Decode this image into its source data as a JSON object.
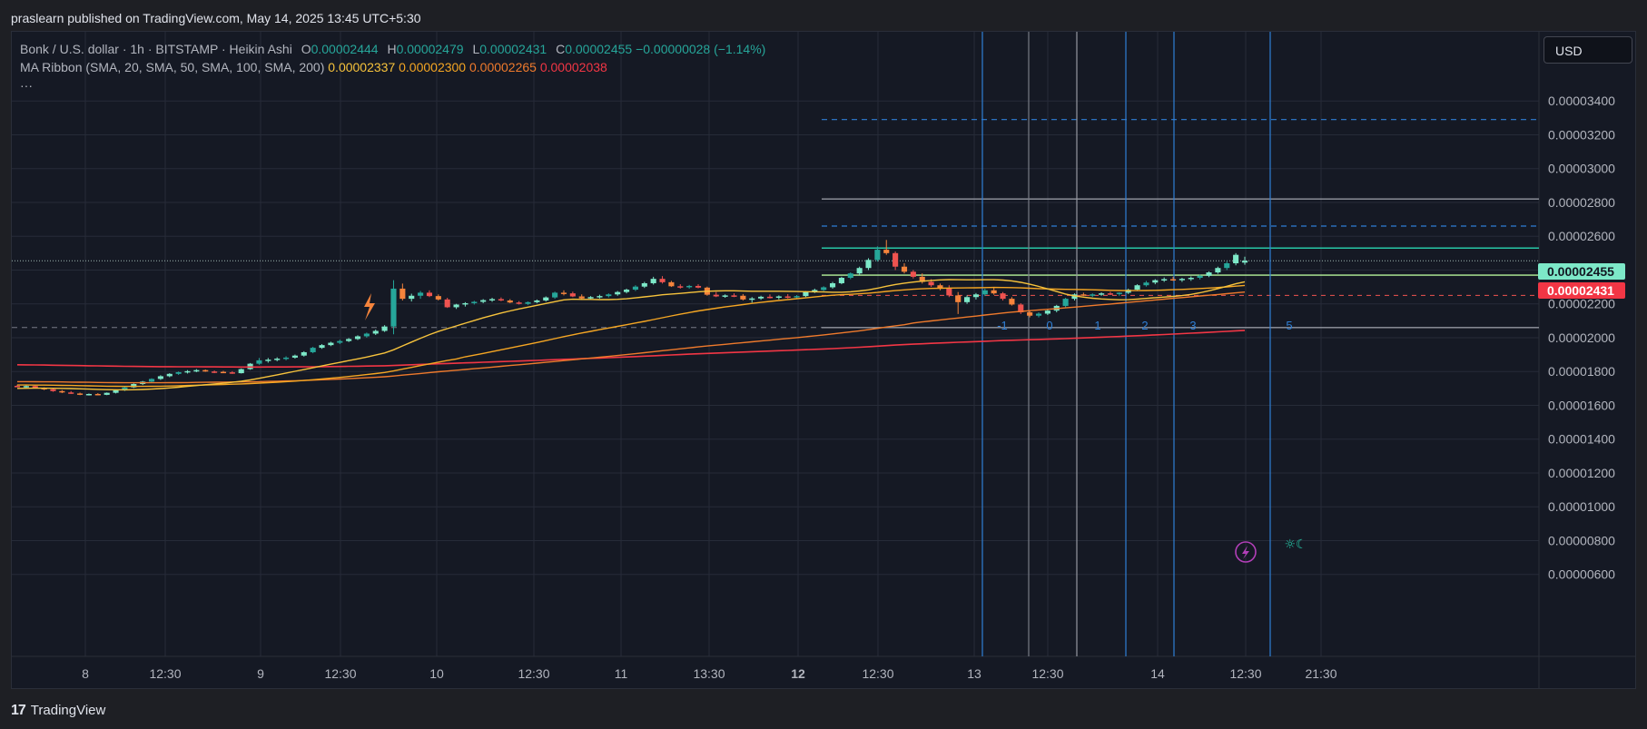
{
  "header": {
    "published": "praslearn published on TradingView.com, May 14, 2025 13:45 UTC+5:30"
  },
  "legend": {
    "symbol": "Bonk / U.S. dollar · 1h · BITSTAMP · Heikin Ashi",
    "o_label": "O",
    "o": "0.00002444",
    "h_label": "H",
    "h": "0.00002479",
    "l_label": "L",
    "l": "0.00002431",
    "c_label": "C",
    "c": "0.00002455",
    "change": "−0.00000028 (−1.14%)",
    "ma_title": "MA Ribbon (SMA, 20, SMA, 50, SMA, 100, SMA, 200)",
    "ma_values": [
      "0.00002337",
      "0.00002300",
      "0.00002265",
      "0.00002038"
    ],
    "more": "···"
  },
  "currency_button": "USD",
  "price_tags": {
    "last": "0.00002455",
    "low": "0.00002431"
  },
  "footer": {
    "brand": "TradingView"
  },
  "colors": {
    "bg": "#151924",
    "up": "#26a69a",
    "up_light": "#7de8c8",
    "down": "#ef5350",
    "down_orange": "#f5843c",
    "ma20": "#f7c33c",
    "ma50": "#f5a623",
    "ma100": "#ef7a2c",
    "ma200": "#f23645",
    "grid": "#262b38",
    "fib_blue": "#2f7fd6",
    "level_teal": "#26c6a6",
    "level_green": "#b7f59a"
  },
  "chart_data": {
    "type": "candlestick",
    "style": "Heikin Ashi",
    "interval": "1h",
    "y_axis": {
      "min": 5e-07,
      "max": 3.5e-06,
      "ticks": [
        "0.00003400",
        "0.00003200",
        "0.00003000",
        "0.00002800",
        "0.00002600",
        "0.00002400",
        "0.00002200",
        "0.00002000",
        "0.00001800",
        "0.00001600",
        "0.00001400",
        "0.00001200",
        "0.00001000",
        "0.00000800",
        "0.00000600"
      ]
    },
    "x_axis": {
      "ticks": [
        "8",
        "12:30",
        "9",
        "12:30",
        "10",
        "12:30",
        "11",
        "13:30",
        "12",
        "12:30",
        "13",
        "12:30",
        "14",
        "12:30",
        "21:30"
      ],
      "bold_ticks": [
        "12"
      ]
    },
    "note": "prices are in units of 1e-8 USD (e.g. 2455 = 0.00002455)",
    "candles": [
      [
        1715,
        1722,
        1708,
        1712
      ],
      [
        1712,
        1720,
        1705,
        1714
      ],
      [
        1714,
        1716,
        1700,
        1702
      ],
      [
        1702,
        1706,
        1690,
        1695
      ],
      [
        1695,
        1700,
        1680,
        1684
      ],
      [
        1684,
        1690,
        1672,
        1676
      ],
      [
        1676,
        1684,
        1668,
        1670
      ],
      [
        1670,
        1675,
        1660,
        1664
      ],
      [
        1664,
        1670,
        1658,
        1667
      ],
      [
        1667,
        1672,
        1660,
        1662
      ],
      [
        1662,
        1676,
        1660,
        1674
      ],
      [
        1674,
        1690,
        1670,
        1688
      ],
      [
        1688,
        1710,
        1684,
        1706
      ],
      [
        1706,
        1730,
        1702,
        1726
      ],
      [
        1726,
        1744,
        1720,
        1740
      ],
      [
        1740,
        1760,
        1734,
        1756
      ],
      [
        1756,
        1778,
        1750,
        1772
      ],
      [
        1772,
        1790,
        1766,
        1786
      ],
      [
        1786,
        1800,
        1780,
        1796
      ],
      [
        1796,
        1808,
        1788,
        1802
      ],
      [
        1802,
        1814,
        1796,
        1808
      ],
      [
        1808,
        1812,
        1798,
        1800
      ],
      [
        1800,
        1806,
        1790,
        1798
      ],
      [
        1798,
        1804,
        1790,
        1795
      ],
      [
        1795,
        1802,
        1786,
        1790
      ],
      [
        1790,
        1818,
        1788,
        1814
      ],
      [
        1814,
        1850,
        1810,
        1846
      ],
      [
        1846,
        1880,
        1840,
        1866
      ],
      [
        1866,
        1880,
        1852,
        1870
      ],
      [
        1870,
        1884,
        1860,
        1876
      ],
      [
        1876,
        1890,
        1866,
        1882
      ],
      [
        1882,
        1900,
        1876,
        1894
      ],
      [
        1894,
        1920,
        1888,
        1914
      ],
      [
        1914,
        1946,
        1908,
        1940
      ],
      [
        1940,
        1962,
        1934,
        1956
      ],
      [
        1956,
        1976,
        1950,
        1970
      ],
      [
        1970,
        1988,
        1962,
        1980
      ],
      [
        1980,
        1998,
        1974,
        1992
      ],
      [
        1992,
        2014,
        1986,
        2008
      ],
      [
        2008,
        2030,
        2000,
        2024
      ],
      [
        2024,
        2048,
        2016,
        2040
      ],
      [
        2040,
        2074,
        2034,
        2066
      ],
      [
        2066,
        2340,
        2020,
        2290
      ],
      [
        2290,
        2320,
        2220,
        2230
      ],
      [
        2230,
        2260,
        2214,
        2248
      ],
      [
        2248,
        2276,
        2230,
        2266
      ],
      [
        2266,
        2280,
        2240,
        2246
      ],
      [
        2246,
        2256,
        2220,
        2226
      ],
      [
        2226,
        2236,
        2176,
        2180
      ],
      [
        2180,
        2200,
        2170,
        2196
      ],
      [
        2196,
        2210,
        2184,
        2204
      ],
      [
        2204,
        2218,
        2196,
        2212
      ],
      [
        2212,
        2228,
        2204,
        2222
      ],
      [
        2222,
        2236,
        2212,
        2228
      ],
      [
        2228,
        2238,
        2216,
        2220
      ],
      [
        2220,
        2228,
        2204,
        2208
      ],
      [
        2208,
        2216,
        2196,
        2200
      ],
      [
        2200,
        2214,
        2194,
        2210
      ],
      [
        2210,
        2226,
        2204,
        2220
      ],
      [
        2220,
        2244,
        2214,
        2238
      ],
      [
        2238,
        2272,
        2230,
        2266
      ],
      [
        2266,
        2280,
        2250,
        2262
      ],
      [
        2262,
        2272,
        2240,
        2244
      ],
      [
        2244,
        2256,
        2228,
        2232
      ],
      [
        2232,
        2246,
        2224,
        2240
      ],
      [
        2240,
        2254,
        2232,
        2246
      ],
      [
        2246,
        2262,
        2238,
        2256
      ],
      [
        2256,
        2276,
        2248,
        2270
      ],
      [
        2270,
        2290,
        2262,
        2284
      ],
      [
        2284,
        2310,
        2276,
        2302
      ],
      [
        2302,
        2330,
        2294,
        2322
      ],
      [
        2322,
        2360,
        2314,
        2348
      ],
      [
        2348,
        2364,
        2320,
        2328
      ],
      [
        2328,
        2336,
        2300,
        2304
      ],
      [
        2304,
        2316,
        2290,
        2300
      ],
      [
        2300,
        2312,
        2290,
        2306
      ],
      [
        2306,
        2316,
        2292,
        2296
      ],
      [
        2296,
        2302,
        2248,
        2254
      ],
      [
        2254,
        2270,
        2240,
        2244
      ],
      [
        2244,
        2256,
        2236,
        2250
      ],
      [
        2250,
        2262,
        2240,
        2248
      ],
      [
        2248,
        2258,
        2220,
        2226
      ],
      [
        2226,
        2240,
        2208,
        2232
      ],
      [
        2232,
        2248,
        2224,
        2242
      ],
      [
        2242,
        2256,
        2232,
        2236
      ],
      [
        2236,
        2250,
        2226,
        2244
      ],
      [
        2244,
        2258,
        2232,
        2238
      ],
      [
        2238,
        2252,
        2228,
        2246
      ],
      [
        2246,
        2276,
        2240,
        2270
      ],
      [
        2270,
        2290,
        2264,
        2282
      ],
      [
        2282,
        2304,
        2276,
        2298
      ],
      [
        2298,
        2330,
        2290,
        2322
      ],
      [
        2322,
        2360,
        2316,
        2354
      ],
      [
        2354,
        2386,
        2346,
        2380
      ],
      [
        2380,
        2420,
        2370,
        2412
      ],
      [
        2412,
        2470,
        2400,
        2460
      ],
      [
        2460,
        2540,
        2450,
        2520
      ],
      [
        2520,
        2578,
        2490,
        2500
      ],
      [
        2500,
        2510,
        2400,
        2420
      ],
      [
        2420,
        2440,
        2380,
        2390
      ],
      [
        2390,
        2400,
        2350,
        2360
      ],
      [
        2360,
        2380,
        2320,
        2330
      ],
      [
        2330,
        2346,
        2300,
        2310
      ],
      [
        2310,
        2320,
        2280,
        2290
      ],
      [
        2290,
        2310,
        2240,
        2250
      ],
      [
        2250,
        2270,
        2140,
        2210
      ],
      [
        2210,
        2250,
        2200,
        2240
      ],
      [
        2240,
        2264,
        2226,
        2256
      ],
      [
        2256,
        2290,
        2246,
        2280
      ],
      [
        2280,
        2300,
        2254,
        2262
      ],
      [
        2262,
        2270,
        2220,
        2230
      ],
      [
        2230,
        2240,
        2190,
        2196
      ],
      [
        2196,
        2204,
        2140,
        2150
      ],
      [
        2150,
        2160,
        2120,
        2130
      ],
      [
        2130,
        2150,
        2120,
        2142
      ],
      [
        2142,
        2168,
        2134,
        2160
      ],
      [
        2160,
        2194,
        2150,
        2188
      ],
      [
        2188,
        2236,
        2180,
        2230
      ],
      [
        2230,
        2262,
        2220,
        2256
      ],
      [
        2256,
        2266,
        2246,
        2250
      ],
      [
        2250,
        2262,
        2240,
        2256
      ],
      [
        2256,
        2268,
        2248,
        2262
      ],
      [
        2262,
        2272,
        2252,
        2258
      ],
      [
        2258,
        2268,
        2248,
        2266
      ],
      [
        2266,
        2290,
        2258,
        2284
      ],
      [
        2284,
        2316,
        2276,
        2310
      ],
      [
        2310,
        2336,
        2302,
        2326
      ],
      [
        2326,
        2346,
        2316,
        2340
      ],
      [
        2340,
        2356,
        2330,
        2346
      ],
      [
        2346,
        2360,
        2336,
        2342
      ],
      [
        2342,
        2354,
        2330,
        2348
      ],
      [
        2348,
        2362,
        2336,
        2354
      ],
      [
        2354,
        2372,
        2344,
        2366
      ],
      [
        2366,
        2392,
        2358,
        2386
      ],
      [
        2386,
        2420,
        2378,
        2412
      ],
      [
        2412,
        2450,
        2400,
        2440
      ],
      [
        2440,
        2500,
        2428,
        2490
      ],
      [
        2444,
        2479,
        2431,
        2455
      ]
    ],
    "moving_averages": [
      {
        "name": "SMA 20",
        "last": "0.00002337"
      },
      {
        "name": "SMA 50",
        "last": "0.00002300"
      },
      {
        "name": "SMA 100",
        "last": "0.00002265"
      },
      {
        "name": "SMA 200",
        "last": "0.00002038"
      }
    ],
    "horizontal_levels": {
      "blue_dashed": [
        3290,
        2660
      ],
      "gray_solid": [
        2820,
        2060
      ],
      "teal_solid": [
        2530
      ],
      "green_solid": [
        2370
      ],
      "red_dashed": [
        2250
      ],
      "last_price_dotted": [
        2455
      ]
    },
    "cycle_labels": [
      "-1",
      "0",
      "1",
      "2",
      "3",
      "5"
    ],
    "gray_dashed_level": 2060
  }
}
